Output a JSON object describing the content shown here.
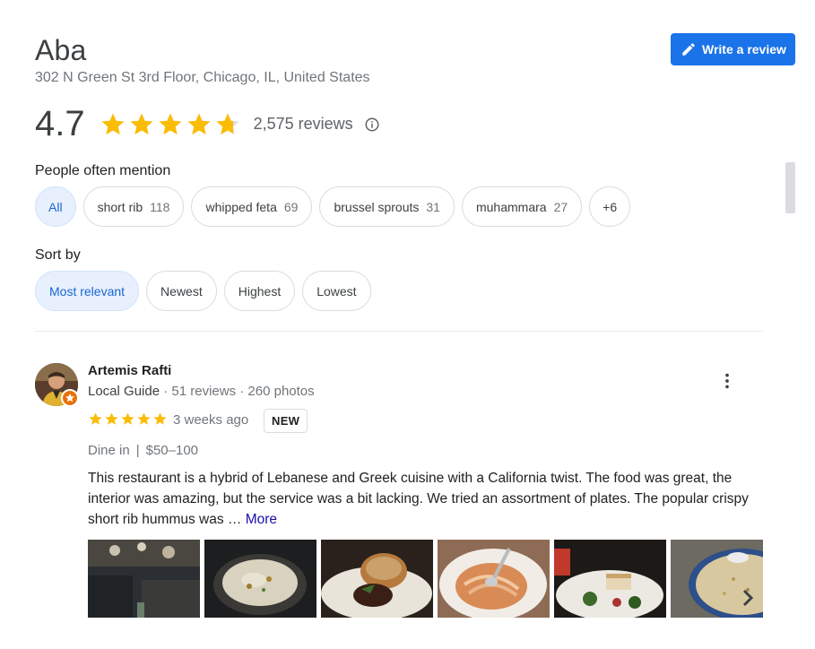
{
  "place": {
    "name": "Aba",
    "address": "302 N Green St 3rd Floor, Chicago, IL, United States"
  },
  "write_review": {
    "label": "Write a review"
  },
  "rating": {
    "value": "4.7",
    "stars": 4.7,
    "review_count": "2,575 reviews"
  },
  "mentions": {
    "label": "People often mention",
    "chips": [
      {
        "label": "All",
        "count": ""
      },
      {
        "label": "short rib",
        "count": "118"
      },
      {
        "label": "whipped feta",
        "count": "69"
      },
      {
        "label": "brussel sprouts",
        "count": "31"
      },
      {
        "label": "muhammara",
        "count": "27"
      },
      {
        "label": "+6",
        "count": ""
      }
    ]
  },
  "sort": {
    "label": "Sort by",
    "options": [
      "Most relevant",
      "Newest",
      "Highest",
      "Lowest"
    ],
    "selected": "Most relevant"
  },
  "review": {
    "author": "Artemis Rafti",
    "guide_label": "Local Guide",
    "meta": " · 51 reviews · 260 photos",
    "stars": 5,
    "time": "3 weeks ago",
    "badge": "NEW",
    "dine_mode": "Dine in",
    "price": "$50–100",
    "text": "This restaurant is a hybrid of Lebanese and Greek cuisine with a California twist. The food was great, the interior was amazing, but the service was a bit lacking. We tried an assortment of plates. The popular crispy short rib hummus was …",
    "more_label": "More"
  },
  "colors": {
    "star": "#fbbc04",
    "star_empty": "#dadce0",
    "accent": "#1a73e8",
    "active_chip_bg": "#e8f0fe",
    "link": "#1a0dab"
  },
  "icons": {
    "write": "pencil-icon",
    "info": "info-icon",
    "more": "more-vert-icon",
    "next": "chevron-right-icon",
    "badge": "local-guide-star-icon"
  }
}
